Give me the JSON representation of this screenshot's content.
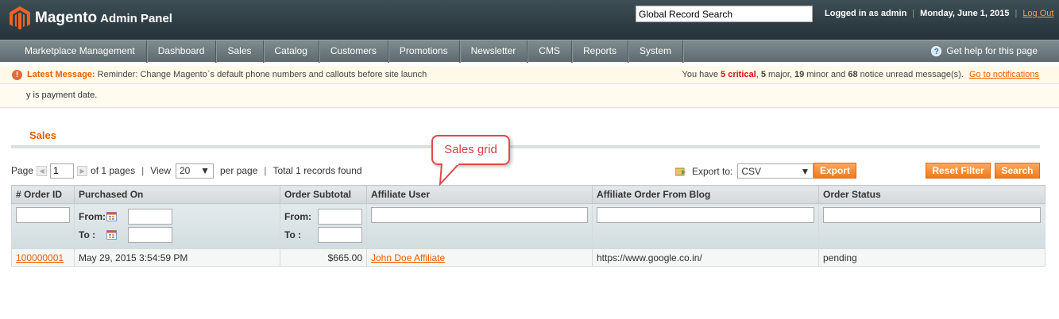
{
  "header": {
    "logo_main": "Magento",
    "logo_sub": "Admin Panel",
    "search_value": "Global Record Search",
    "logged_in": "Logged in as admin",
    "date": "Monday, June 1, 2015",
    "logout": "Log Out"
  },
  "nav": {
    "items": [
      "Marketplace Management",
      "Dashboard",
      "Sales",
      "Catalog",
      "Customers",
      "Promotions",
      "Newsletter",
      "CMS",
      "Reports",
      "System"
    ],
    "help": "Get help for this page"
  },
  "message": {
    "label": "Latest Message:",
    "text": "Reminder: Change Magento`s default phone numbers and callouts before site launch",
    "you_have": "You have",
    "critical": "5 critical",
    "major_count": "5",
    "major_text": "major,",
    "minor_count": "19",
    "minor_text": "minor and",
    "notice_count": "68",
    "notice_text": "notice unread message(s).",
    "link": "Go to notifications"
  },
  "notice_text": "y is payment date.",
  "page_title": "Sales",
  "callout_text": "Sales grid",
  "pager": {
    "page_label": "Page",
    "page_value": "1",
    "of_pages": "of 1 pages",
    "view_label": "View",
    "per_page_value": "20",
    "per_page_label": "per page",
    "total": "Total 1 records found"
  },
  "export": {
    "label": "Export to:",
    "format": "CSV",
    "button": "Export"
  },
  "buttons": {
    "reset": "Reset Filter",
    "search": "Search"
  },
  "grid": {
    "columns": [
      "# Order ID",
      "Purchased On",
      "Order Subtotal",
      "Affiliate User",
      "Affiliate Order From Blog",
      "Order Status"
    ],
    "from_label": "From:",
    "to_label": "To :",
    "rows": [
      {
        "order_id": "100000001",
        "purchased_on": "May 29, 2015 3:54:59 PM",
        "subtotal": "$665.00",
        "affiliate_user": "John Doe Affiliate",
        "blog": "https://www.google.co.in/",
        "status": "pending"
      }
    ]
  },
  "colors": {
    "accent": "#eb5e00",
    "header_bg": "#2d3d44",
    "nav_bg": "#6e7b80",
    "button": "#f07a1c"
  }
}
